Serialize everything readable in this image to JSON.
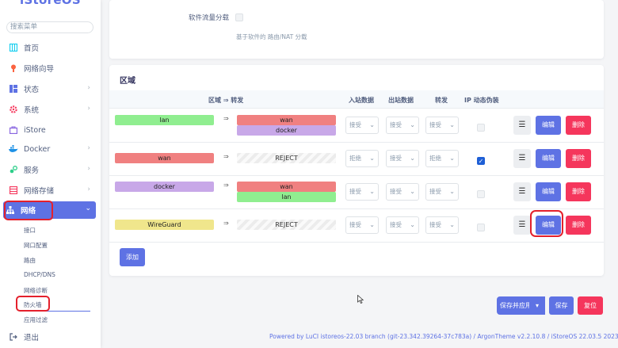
{
  "sidebar": {
    "brand": "iStoreOS",
    "search_placeholder": "搜索菜单",
    "items": [
      {
        "label": "首页",
        "icon": "home-icon"
      },
      {
        "label": "网络向导",
        "icon": "wizard-icon"
      },
      {
        "label": "状态",
        "icon": "status-icon"
      },
      {
        "label": "系统",
        "icon": "system-icon"
      },
      {
        "label": "iStore",
        "icon": "store-icon"
      },
      {
        "label": "Docker",
        "icon": "docker-icon"
      },
      {
        "label": "服务",
        "icon": "services-icon"
      },
      {
        "label": "网络存储",
        "icon": "storage-icon"
      },
      {
        "label": "网络",
        "icon": "network-icon"
      },
      {
        "label": "退出",
        "icon": "logout-icon"
      }
    ],
    "subitems": [
      "接口",
      "网口配置",
      "路由",
      "DHCP/DNS",
      "网络诊断",
      "防火墙",
      "应用过滤"
    ]
  },
  "settings": {
    "flow_offload_label": "软件流量分载",
    "flow_offload_hint": "基于软件的 路由/NAT 分载"
  },
  "zones": {
    "title": "区域",
    "headers": {
      "zone_forward": "区域 ⇒ 转发",
      "input": "入站数据",
      "output": "出站数据",
      "forward": "转发",
      "masq": "IP 动态伪装"
    },
    "arrow": "⇒",
    "rows": [
      {
        "zone": "lan",
        "targets": [
          "wan",
          "docker"
        ],
        "input": "接受",
        "output": "接受",
        "forward": "接受",
        "masq": false
      },
      {
        "zone": "wan",
        "targets": [
          "REJECT"
        ],
        "input": "拒绝",
        "output": "接受",
        "forward": "拒绝",
        "masq": true
      },
      {
        "zone": "docker",
        "targets": [
          "wan",
          "lan"
        ],
        "input": "接受",
        "output": "接受",
        "forward": "接受",
        "masq": false
      },
      {
        "zone": "WireGuard",
        "targets": [
          "REJECT"
        ],
        "input": "接受",
        "output": "接受",
        "forward": "接受",
        "masq": false
      }
    ],
    "edit_label": "编辑",
    "delete_label": "删除",
    "menu_glyph": "☰",
    "add_label": "添加"
  },
  "actions": {
    "save_apply": "保存并应用",
    "save": "保存",
    "reset": "复位"
  },
  "footer": "Powered by LuCI istoreos-22.03 branch (git-23.342.39264-37c783a) / ArgonTheme v2.2.10.8 / iStoreOS 22.03.5 2023121510",
  "colors": {
    "accent": "#5e72e4",
    "danger": "#f5365c",
    "lan": "#90ee90",
    "wan": "#f08080",
    "docker": "#c8a8e8",
    "wireguard": "#f0e68c"
  }
}
